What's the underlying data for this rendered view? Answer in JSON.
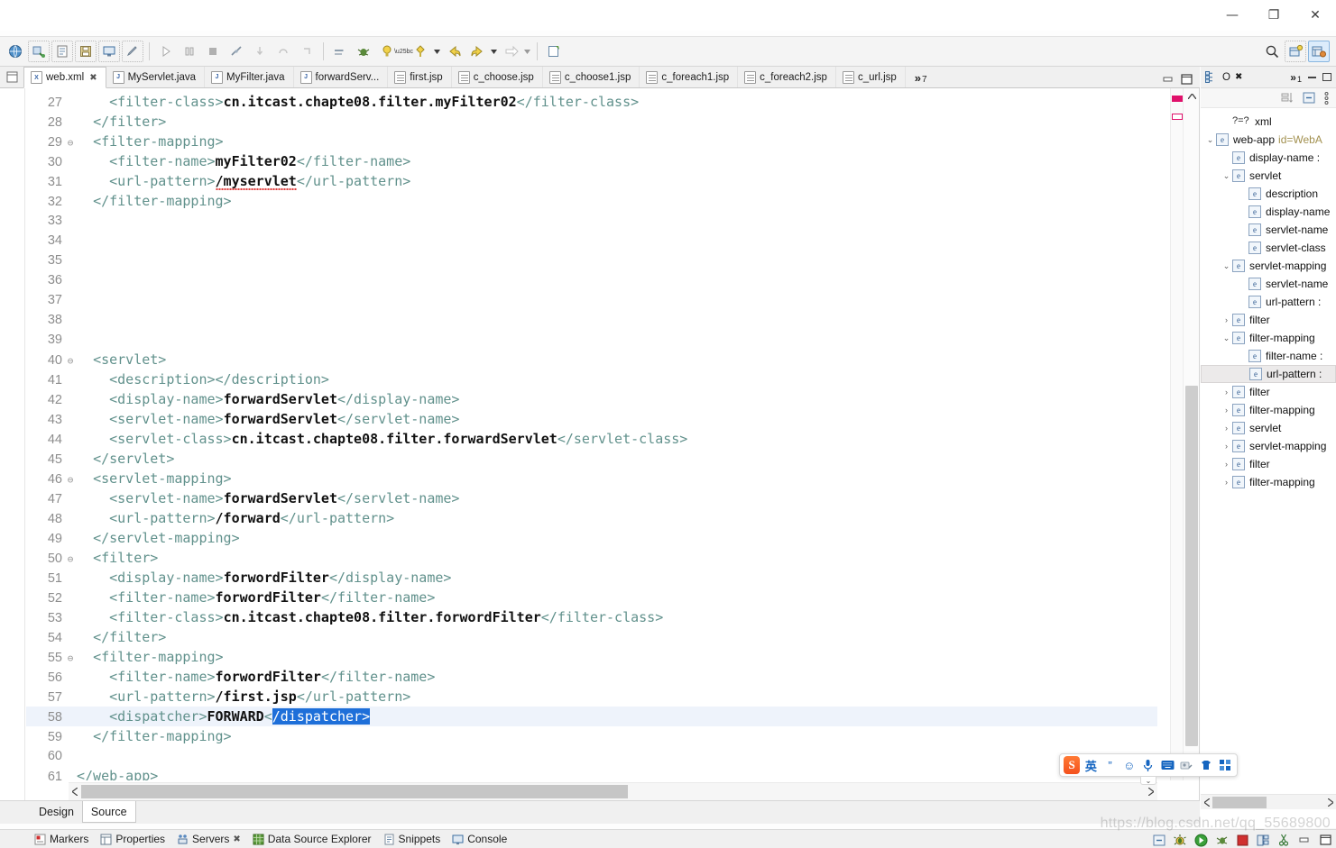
{
  "window": {
    "minimize_label": "—",
    "maximize_label": "❐",
    "close_label": "✕"
  },
  "toolbar": {
    "items": [
      {
        "name": "open-web-browser-icon",
        "glyph": "🌐"
      },
      {
        "name": "new-connection-icon",
        "glyph": "↯"
      },
      {
        "name": "new-xml-file-icon",
        "glyph": "⌗"
      },
      {
        "name": "save-icon",
        "glyph": "⎓"
      },
      {
        "name": "open-console-icon",
        "glyph": "▣"
      },
      {
        "name": "quick-access-icon",
        "glyph": "✐"
      },
      {
        "name": "run-icon",
        "glyph": "▷"
      },
      {
        "name": "pause-icon",
        "glyph": "‖"
      },
      {
        "name": "stop-icon",
        "glyph": "■"
      },
      {
        "name": "disconnect-icon",
        "glyph": "⌗"
      },
      {
        "name": "step-into-icon",
        "glyph": "⤵"
      },
      {
        "name": "step-over-icon",
        "glyph": "⤴"
      },
      {
        "name": "step-return-icon",
        "glyph": "↱"
      },
      {
        "name": "run-last-tool-icon",
        "glyph": "⇒"
      },
      {
        "name": "debug-icon",
        "glyph": "🐞"
      },
      {
        "name": "run-as-icon",
        "glyph": "▶"
      },
      {
        "name": "external-tools-icon",
        "glyph": "⚙"
      },
      {
        "name": "back-icon",
        "glyph": "↩"
      },
      {
        "name": "forward-nav-icon",
        "glyph": "↪"
      },
      {
        "name": "next-edit-icon",
        "glyph": "⇒"
      },
      {
        "name": "new-editor-icon",
        "glyph": "⎘"
      }
    ],
    "right_items": [
      {
        "name": "search-icon",
        "glyph": "🔍"
      },
      {
        "name": "open-perspective-icon",
        "glyph": "⊞"
      },
      {
        "name": "java-ee-perspective-icon",
        "glyph": "▦"
      }
    ]
  },
  "editor_tabs": {
    "left_icon": "restore-editor-icon",
    "tabs": [
      {
        "label": "web.xml",
        "icon": "xml-file-icon",
        "badge": "X",
        "active": true,
        "closable": true
      },
      {
        "label": "MyServlet.java",
        "icon": "java-file-icon",
        "badge": "J",
        "active": false,
        "closable": false
      },
      {
        "label": "MyFilter.java",
        "icon": "java-file-icon",
        "badge": "J",
        "active": false,
        "closable": false
      },
      {
        "label": "forwardServ...",
        "icon": "java-file-icon",
        "badge": "J",
        "active": false,
        "closable": false
      },
      {
        "label": "first.jsp",
        "icon": "jsp-file-icon",
        "badge": "",
        "active": false,
        "closable": false
      },
      {
        "label": "c_choose.jsp",
        "icon": "jsp-file-icon",
        "badge": "",
        "active": false,
        "closable": false
      },
      {
        "label": "c_choose1.jsp",
        "icon": "jsp-file-icon",
        "badge": "",
        "active": false,
        "closable": false
      },
      {
        "label": "c_foreach1.jsp",
        "icon": "jsp-file-icon",
        "badge": "",
        "active": false,
        "closable": false
      },
      {
        "label": "c_foreach2.jsp",
        "icon": "jsp-file-icon",
        "badge": "",
        "active": false,
        "closable": false
      },
      {
        "label": "c_url.jsp",
        "icon": "jsp-file-icon",
        "badge": "",
        "active": false,
        "closable": false
      }
    ],
    "overflow_chevron": "»",
    "overflow_count": "7",
    "minimize_label": "–",
    "maximize_label": "❐"
  },
  "code": {
    "file": "web.xml",
    "first_line": 27,
    "current_line": 58,
    "selection_text": "/dispatcher>",
    "lines": [
      {
        "n": 27,
        "fold": "",
        "indent": 4,
        "parts": [
          {
            "t": "tg",
            "s": "<filter-class>"
          },
          {
            "t": "txt",
            "s": "cn.itcast.chapte08.filter.myFilter02"
          },
          {
            "t": "tg",
            "s": "</filter-class>"
          }
        ]
      },
      {
        "n": 28,
        "fold": "",
        "indent": 2,
        "parts": [
          {
            "t": "tg",
            "s": "</filter>"
          }
        ]
      },
      {
        "n": 29,
        "fold": "⊖",
        "indent": 2,
        "parts": [
          {
            "t": "tg",
            "s": "<filter-mapping>"
          }
        ]
      },
      {
        "n": 30,
        "fold": "",
        "indent": 4,
        "parts": [
          {
            "t": "tg",
            "s": "<filter-name>"
          },
          {
            "t": "txt",
            "s": "myFilter02"
          },
          {
            "t": "tg",
            "s": "</filter-name>"
          }
        ]
      },
      {
        "n": 31,
        "fold": "",
        "indent": 4,
        "parts": [
          {
            "t": "tg",
            "s": "<url-pattern>"
          },
          {
            "t": "txt-err",
            "s": "/myservlet"
          },
          {
            "t": "tg",
            "s": "</url-pattern>"
          }
        ]
      },
      {
        "n": 32,
        "fold": "",
        "indent": 2,
        "parts": [
          {
            "t": "tg",
            "s": "</filter-mapping>"
          }
        ]
      },
      {
        "n": 33,
        "fold": "",
        "indent": 0,
        "parts": []
      },
      {
        "n": 34,
        "fold": "",
        "indent": 0,
        "parts": []
      },
      {
        "n": 35,
        "fold": "",
        "indent": 0,
        "parts": []
      },
      {
        "n": 36,
        "fold": "",
        "indent": 0,
        "parts": []
      },
      {
        "n": 37,
        "fold": "",
        "indent": 0,
        "parts": []
      },
      {
        "n": 38,
        "fold": "",
        "indent": 0,
        "parts": []
      },
      {
        "n": 39,
        "fold": "",
        "indent": 0,
        "parts": []
      },
      {
        "n": 40,
        "fold": "⊖",
        "indent": 2,
        "parts": [
          {
            "t": "tg",
            "s": "<servlet>"
          }
        ]
      },
      {
        "n": 41,
        "fold": "",
        "indent": 4,
        "parts": [
          {
            "t": "tg",
            "s": "<description></description>"
          }
        ]
      },
      {
        "n": 42,
        "fold": "",
        "indent": 4,
        "parts": [
          {
            "t": "tg",
            "s": "<display-name>"
          },
          {
            "t": "txt",
            "s": "forwardServlet"
          },
          {
            "t": "tg",
            "s": "</display-name>"
          }
        ]
      },
      {
        "n": 43,
        "fold": "",
        "indent": 4,
        "parts": [
          {
            "t": "tg",
            "s": "<servlet-name>"
          },
          {
            "t": "txt",
            "s": "forwardServlet"
          },
          {
            "t": "tg",
            "s": "</servlet-name>"
          }
        ]
      },
      {
        "n": 44,
        "fold": "",
        "indent": 4,
        "parts": [
          {
            "t": "tg",
            "s": "<servlet-class>"
          },
          {
            "t": "txt",
            "s": "cn.itcast.chapte08.filter.forwardServlet"
          },
          {
            "t": "tg",
            "s": "</servlet-class>"
          }
        ]
      },
      {
        "n": 45,
        "fold": "",
        "indent": 2,
        "parts": [
          {
            "t": "tg",
            "s": "</servlet>"
          }
        ]
      },
      {
        "n": 46,
        "fold": "⊖",
        "indent": 2,
        "parts": [
          {
            "t": "tg",
            "s": "<servlet-mapping>"
          }
        ]
      },
      {
        "n": 47,
        "fold": "",
        "indent": 4,
        "parts": [
          {
            "t": "tg",
            "s": "<servlet-name>"
          },
          {
            "t": "txt",
            "s": "forwardServlet"
          },
          {
            "t": "tg",
            "s": "</servlet-name>"
          }
        ]
      },
      {
        "n": 48,
        "fold": "",
        "indent": 4,
        "parts": [
          {
            "t": "tg",
            "s": "<url-pattern>"
          },
          {
            "t": "txt",
            "s": "/forward"
          },
          {
            "t": "tg",
            "s": "</url-pattern>"
          }
        ]
      },
      {
        "n": 49,
        "fold": "",
        "indent": 2,
        "parts": [
          {
            "t": "tg",
            "s": "</servlet-mapping>"
          }
        ]
      },
      {
        "n": 50,
        "fold": "⊖",
        "indent": 2,
        "parts": [
          {
            "t": "tg",
            "s": "<filter>"
          }
        ]
      },
      {
        "n": 51,
        "fold": "",
        "indent": 4,
        "parts": [
          {
            "t": "tg",
            "s": "<display-name>"
          },
          {
            "t": "txt",
            "s": "forwordFilter"
          },
          {
            "t": "tg",
            "s": "</display-name>"
          }
        ]
      },
      {
        "n": 52,
        "fold": "",
        "indent": 4,
        "parts": [
          {
            "t": "tg",
            "s": "<filter-name>"
          },
          {
            "t": "txt",
            "s": "forwordFilter"
          },
          {
            "t": "tg",
            "s": "</filter-name>"
          }
        ]
      },
      {
        "n": 53,
        "fold": "",
        "indent": 4,
        "parts": [
          {
            "t": "tg",
            "s": "<filter-class>"
          },
          {
            "t": "txt",
            "s": "cn.itcast.chapte08.filter.forwordFilter"
          },
          {
            "t": "tg",
            "s": "</filter-class>"
          }
        ]
      },
      {
        "n": 54,
        "fold": "",
        "indent": 2,
        "parts": [
          {
            "t": "tg",
            "s": "</filter>"
          }
        ]
      },
      {
        "n": 55,
        "fold": "⊖",
        "indent": 2,
        "parts": [
          {
            "t": "tg",
            "s": "<filter-mapping>"
          }
        ]
      },
      {
        "n": 56,
        "fold": "",
        "indent": 4,
        "parts": [
          {
            "t": "tg",
            "s": "<filter-name>"
          },
          {
            "t": "txt",
            "s": "forwordFilter"
          },
          {
            "t": "tg",
            "s": "</filter-name>"
          }
        ]
      },
      {
        "n": 57,
        "fold": "",
        "indent": 4,
        "parts": [
          {
            "t": "tg",
            "s": "<url-pattern>"
          },
          {
            "t": "txt",
            "s": "/first.jsp"
          },
          {
            "t": "tg",
            "s": "</url-pattern>"
          }
        ]
      },
      {
        "n": 58,
        "fold": "",
        "indent": 4,
        "current": true,
        "parts": [
          {
            "t": "tg",
            "s": "<dispatcher>"
          },
          {
            "t": "txt",
            "s": "FORWARD"
          },
          {
            "t": "tg",
            "s": "<"
          },
          {
            "t": "sel",
            "s": "/dispatcher>"
          }
        ]
      },
      {
        "n": 59,
        "fold": "",
        "indent": 2,
        "parts": [
          {
            "t": "tg",
            "s": "</filter-mapping>"
          }
        ]
      },
      {
        "n": 60,
        "fold": "",
        "indent": 0,
        "parts": []
      },
      {
        "n": 61,
        "fold": "",
        "indent": 0,
        "parts": [
          {
            "t": "tg",
            "s": "</web-app>"
          }
        ]
      }
    ]
  },
  "design_source": {
    "design_label": "Design",
    "source_label": "Source",
    "active": "Source"
  },
  "bottom_views": [
    {
      "label": "Markers",
      "icon": "markers-icon",
      "closable": false
    },
    {
      "label": "Properties",
      "icon": "properties-icon",
      "closable": false
    },
    {
      "label": "Servers",
      "icon": "servers-icon",
      "closable": true,
      "close_glyph": "✖"
    },
    {
      "label": "Data Source Explorer",
      "icon": "data-source-explorer-icon",
      "closable": false
    },
    {
      "label": "Snippets",
      "icon": "snippets-icon",
      "closable": false
    },
    {
      "label": "Console",
      "icon": "console-icon",
      "closable": false
    }
  ],
  "outline": {
    "tab_label": "O",
    "tab_close": "✖",
    "overflow_chevron": "»",
    "overflow_count": "1",
    "tools": [
      {
        "name": "sort-icon",
        "glyph": "⇅"
      },
      {
        "name": "collapse-all-icon",
        "glyph": "⊟"
      },
      {
        "name": "view-menu-icon",
        "glyph": "⋮"
      }
    ],
    "tree": [
      {
        "depth": 1,
        "arrow": "",
        "badge": "?=?",
        "badge_type": "pi",
        "label": "xml",
        "attr": "",
        "selected": false
      },
      {
        "depth": 0,
        "arrow": "⌄",
        "badge": "e",
        "badge_type": "el",
        "label": "web-app",
        "attr": "id=WebA",
        "selected": false
      },
      {
        "depth": 1,
        "arrow": "",
        "badge": "e",
        "badge_type": "el",
        "label": "display-name :",
        "attr": "",
        "selected": false
      },
      {
        "depth": 1,
        "arrow": "⌄",
        "badge": "e",
        "badge_type": "el",
        "label": "servlet",
        "attr": "",
        "selected": false
      },
      {
        "depth": 2,
        "arrow": "",
        "badge": "e",
        "badge_type": "el",
        "label": "description",
        "attr": "",
        "selected": false
      },
      {
        "depth": 2,
        "arrow": "",
        "badge": "e",
        "badge_type": "el",
        "label": "display-name",
        "attr": "",
        "selected": false
      },
      {
        "depth": 2,
        "arrow": "",
        "badge": "e",
        "badge_type": "el",
        "label": "servlet-name",
        "attr": "",
        "selected": false
      },
      {
        "depth": 2,
        "arrow": "",
        "badge": "e",
        "badge_type": "el",
        "label": "servlet-class",
        "attr": "",
        "selected": false
      },
      {
        "depth": 1,
        "arrow": "⌄",
        "badge": "e",
        "badge_type": "el",
        "label": "servlet-mapping",
        "attr": "",
        "selected": false
      },
      {
        "depth": 2,
        "arrow": "",
        "badge": "e",
        "badge_type": "el",
        "label": "servlet-name",
        "attr": "",
        "selected": false
      },
      {
        "depth": 2,
        "arrow": "",
        "badge": "e",
        "badge_type": "el",
        "label": "url-pattern :",
        "attr": "",
        "selected": false
      },
      {
        "depth": 1,
        "arrow": "›",
        "badge": "e",
        "badge_type": "el",
        "label": "filter",
        "attr": "",
        "selected": false
      },
      {
        "depth": 1,
        "arrow": "⌄",
        "badge": "e",
        "badge_type": "el",
        "label": "filter-mapping",
        "attr": "",
        "selected": false
      },
      {
        "depth": 2,
        "arrow": "",
        "badge": "e",
        "badge_type": "el",
        "label": "filter-name :",
        "attr": "",
        "selected": false
      },
      {
        "depth": 2,
        "arrow": "",
        "badge": "e",
        "badge_type": "el",
        "label": "url-pattern :",
        "attr": "",
        "selected": true
      },
      {
        "depth": 1,
        "arrow": "›",
        "badge": "e",
        "badge_type": "el",
        "label": "filter",
        "attr": "",
        "selected": false
      },
      {
        "depth": 1,
        "arrow": "›",
        "badge": "e",
        "badge_type": "el",
        "label": "filter-mapping",
        "attr": "",
        "selected": false
      },
      {
        "depth": 1,
        "arrow": "›",
        "badge": "e",
        "badge_type": "el",
        "label": "servlet",
        "attr": "",
        "selected": false
      },
      {
        "depth": 1,
        "arrow": "›",
        "badge": "e",
        "badge_type": "el",
        "label": "servlet-mapping",
        "attr": "",
        "selected": false
      },
      {
        "depth": 1,
        "arrow": "›",
        "badge": "e",
        "badge_type": "el",
        "label": "filter",
        "attr": "",
        "selected": false
      },
      {
        "depth": 1,
        "arrow": "›",
        "badge": "e",
        "badge_type": "el",
        "label": "filter-mapping",
        "attr": "",
        "selected": false
      }
    ]
  },
  "ime": {
    "logo_text": "S",
    "mode_label": "英",
    "buttons": [
      {
        "name": "ime-punctuation-icon",
        "glyph": "”"
      },
      {
        "name": "ime-emoji-icon",
        "glyph": "☺"
      },
      {
        "name": "ime-voice-icon",
        "glyph": "🎤"
      },
      {
        "name": "ime-soft-keyboard-icon",
        "glyph": "⌨"
      },
      {
        "name": "ime-handwriting-icon",
        "glyph": "✎"
      },
      {
        "name": "ime-skin-icon",
        "glyph": "👕"
      },
      {
        "name": "ime-toolbox-icon",
        "glyph": "⊞"
      }
    ],
    "collapse_glyph": "⌄"
  },
  "tray": {
    "icons": [
      {
        "name": "minimize-tray-icon",
        "glyph": "⊟"
      },
      {
        "name": "bug-tray-icon",
        "glyph": "☀"
      },
      {
        "name": "run-tray-icon",
        "glyph": "▶"
      },
      {
        "name": "debug-tray-icon",
        "glyph": "↗"
      },
      {
        "name": "stop-tray-icon",
        "glyph": "■"
      },
      {
        "name": "servers-tray-icon",
        "glyph": "▤"
      },
      {
        "name": "link-tray-icon",
        "glyph": "✂"
      },
      {
        "name": "restore-tray-icon",
        "glyph": "–"
      },
      {
        "name": "maximize-tray-icon",
        "glyph": "❐"
      }
    ]
  },
  "watermark": {
    "text": "https://blog.csdn.net/qq_55689800"
  }
}
